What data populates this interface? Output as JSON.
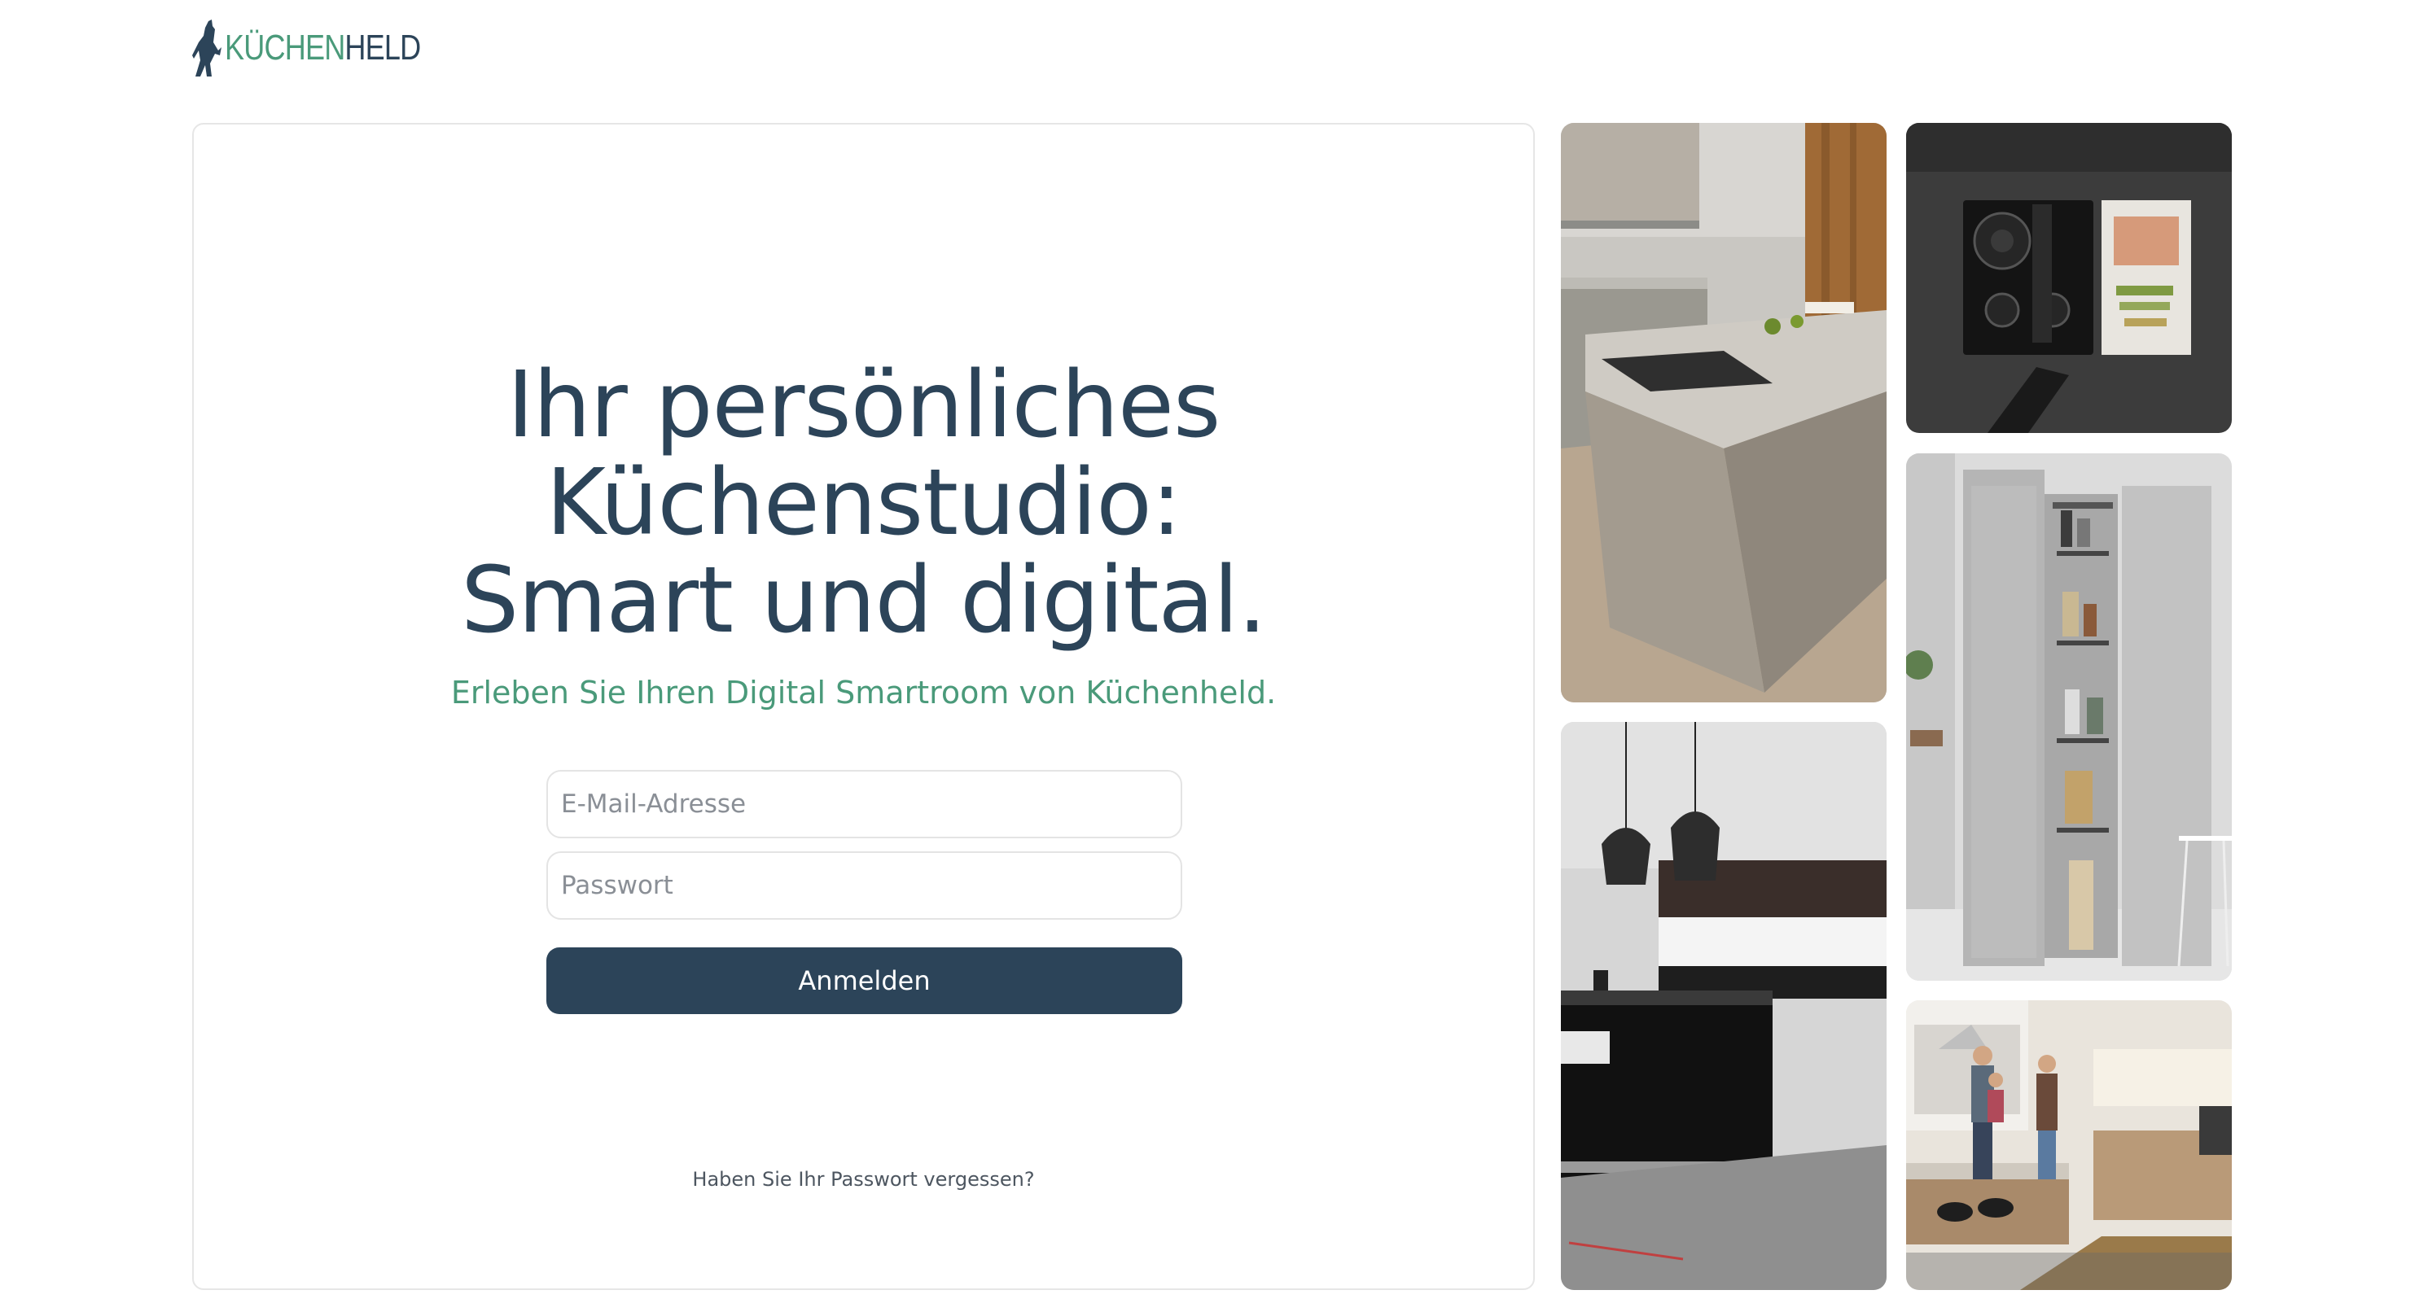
{
  "brand": {
    "logo_part1": "KÜCHEN",
    "logo_part2": "HELD",
    "colors": {
      "navy": "#2c4459",
      "green": "#4a9a7a"
    }
  },
  "login": {
    "headline_line1": "Ihr persönliches",
    "headline_line2": "Küchenstudio:",
    "headline_line3": "Smart und digital.",
    "subline": "Erleben Sie Ihren Digital Smartroom von Küchenheld.",
    "email_placeholder": "E-Mail-Adresse",
    "email_value": "",
    "password_placeholder": "Passwort",
    "password_value": "",
    "submit_label": "Anmelden",
    "forgot_label": "Haben Sie Ihr Passwort vergessen?"
  },
  "gallery": {
    "images": [
      {
        "subject": "kitchen-island-concrete"
      },
      {
        "subject": "cooktop-top-view"
      },
      {
        "subject": "pull-out-pantry-cabinet"
      },
      {
        "subject": "black-gloss-kitchen-pendant-lamps"
      },
      {
        "subject": "family-in-kitchen"
      }
    ]
  }
}
